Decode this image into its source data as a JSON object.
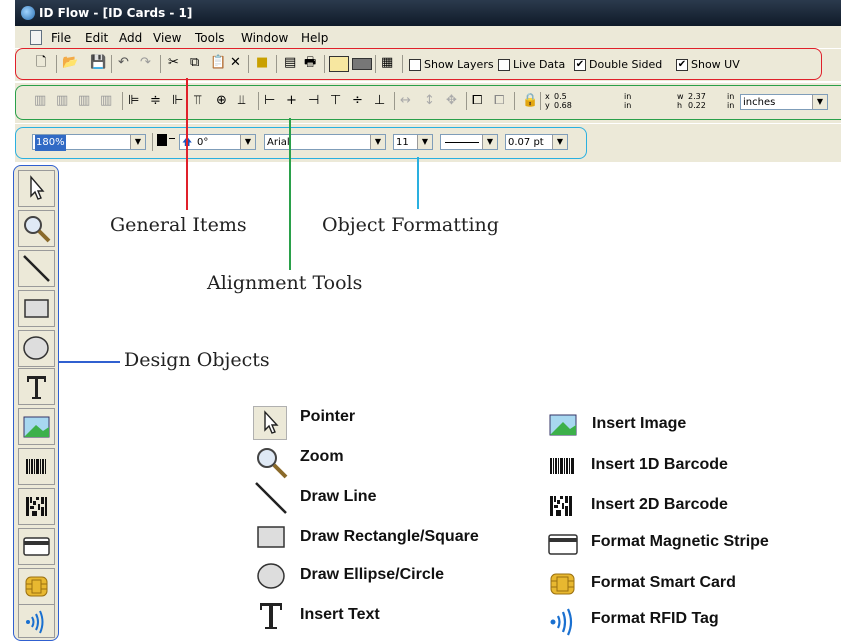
{
  "window": {
    "title": "ID Flow - [ID Cards - 1]"
  },
  "menu": [
    "File",
    "Edit",
    "Add",
    "View",
    "Tools",
    "Window",
    "Help"
  ],
  "toolbar1": {
    "show_layers": {
      "label": "Show Layers",
      "checked": false
    },
    "live_data": {
      "label": "Live Data",
      "checked": false
    },
    "double_sided": {
      "label": "Double Sided",
      "checked": true
    },
    "show_uv": {
      "label": "Show UV",
      "checked": true
    },
    "check_mark": "✔"
  },
  "toolbar2": {
    "x_label": "x",
    "x_value": "0.5",
    "x_unit": "in",
    "y_label": "y",
    "y_value": "0.68",
    "y_unit": "in",
    "w_label": "w",
    "w_value": "2.37",
    "w_unit": "in",
    "h_label": "h",
    "h_value": "0.22",
    "h_unit": "in",
    "units_value": "inches"
  },
  "toolbar3": {
    "zoom_value": "180%",
    "rotation_value": "0°",
    "font_value": "Arial",
    "size_value": "11",
    "line_weight": "0.07 pt"
  },
  "callouts": {
    "general": "General Items",
    "alignment": "Alignment Tools",
    "formatting": "Object Formatting",
    "design": "Design Objects"
  },
  "legend": {
    "left": [
      "Pointer",
      "Zoom",
      "Draw Line",
      "Draw Rectangle/Square",
      "Draw Ellipse/Circle",
      "Insert Text"
    ],
    "right": [
      "Insert Image",
      "Insert 1D Barcode",
      "Insert 2D Barcode",
      "Format Magnetic Stripe",
      "Format Smart Card",
      "Format RFID Tag"
    ]
  },
  "colors": {
    "general": "#e0202a",
    "alignment": "#2aa04a",
    "formatting": "#2ab0e0",
    "design": "#3060d0"
  }
}
